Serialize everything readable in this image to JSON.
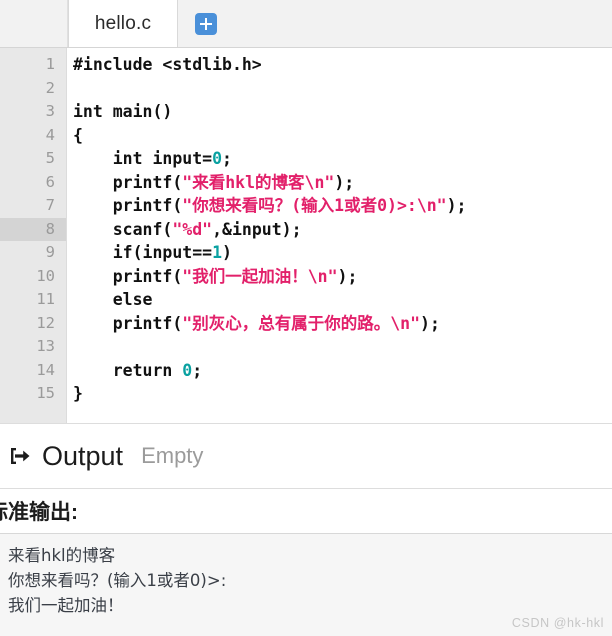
{
  "tabbar": {
    "tab_label": "hello.c",
    "add_tab_title": "+"
  },
  "editor": {
    "active_line": 8,
    "line_numbers": [
      "1",
      "2",
      "3",
      "4",
      "5",
      "6",
      "7",
      "8",
      "9",
      "10",
      "11",
      "12",
      "13",
      "14",
      "15"
    ],
    "lines": [
      {
        "n": 1,
        "parts": [
          {
            "t": "plain",
            "v": "#include <stdlib.h>"
          }
        ]
      },
      {
        "n": 2,
        "parts": [
          {
            "t": "plain",
            "v": ""
          }
        ]
      },
      {
        "n": 3,
        "parts": [
          {
            "t": "plain",
            "v": "int main()"
          }
        ]
      },
      {
        "n": 4,
        "parts": [
          {
            "t": "plain",
            "v": "{"
          }
        ]
      },
      {
        "n": 5,
        "parts": [
          {
            "t": "plain",
            "v": "    int input="
          },
          {
            "t": "num",
            "v": "0"
          },
          {
            "t": "plain",
            "v": ";"
          }
        ]
      },
      {
        "n": 6,
        "parts": [
          {
            "t": "plain",
            "v": "    printf("
          },
          {
            "t": "str",
            "v": "\"来看hkl的博客\\n\""
          },
          {
            "t": "plain",
            "v": ");"
          }
        ]
      },
      {
        "n": 7,
        "parts": [
          {
            "t": "plain",
            "v": "    printf("
          },
          {
            "t": "str",
            "v": "\"你想来看吗？(输入1或者0)>:\\n\""
          },
          {
            "t": "plain",
            "v": ");"
          }
        ]
      },
      {
        "n": 8,
        "parts": [
          {
            "t": "plain",
            "v": "    scanf("
          },
          {
            "t": "str",
            "v": "\"%d\""
          },
          {
            "t": "plain",
            "v": ",&input);"
          }
        ]
      },
      {
        "n": 9,
        "parts": [
          {
            "t": "plain",
            "v": "    if(input=="
          },
          {
            "t": "num",
            "v": "1"
          },
          {
            "t": "plain",
            "v": ")"
          }
        ]
      },
      {
        "n": 10,
        "parts": [
          {
            "t": "plain",
            "v": "    printf("
          },
          {
            "t": "str",
            "v": "\"我们一起加油！\\n\""
          },
          {
            "t": "plain",
            "v": ");"
          }
        ]
      },
      {
        "n": 11,
        "parts": [
          {
            "t": "plain",
            "v": "    else"
          }
        ]
      },
      {
        "n": 12,
        "parts": [
          {
            "t": "plain",
            "v": "    printf("
          },
          {
            "t": "str",
            "v": "\"别灰心，总有属于你的路。\\n\""
          },
          {
            "t": "plain",
            "v": ");"
          }
        ]
      },
      {
        "n": 13,
        "parts": [
          {
            "t": "plain",
            "v": ""
          }
        ]
      },
      {
        "n": 14,
        "parts": [
          {
            "t": "plain",
            "v": "    return "
          },
          {
            "t": "num",
            "v": "0"
          },
          {
            "t": "plain",
            "v": ";"
          }
        ]
      },
      {
        "n": 15,
        "parts": [
          {
            "t": "plain",
            "v": "}"
          }
        ]
      }
    ]
  },
  "output_bar": {
    "icon": "sign-out-icon",
    "title": "Output",
    "status": "Empty"
  },
  "stdout_panel": {
    "header": "标准输出:",
    "lines": [
      "来看hkl的博客",
      "你想来看吗？(输入1或者0)>:",
      "我们一起加油！"
    ]
  },
  "watermark": {
    "text": "CSDN @hk-hkl"
  },
  "colors": {
    "string": "#e2206a",
    "number": "#0aa1a1",
    "accent_blue": "#4a90d9",
    "gutter_bg": "#e8e8e8",
    "gutter_active": "#d4d4d4",
    "console_bg": "#f6f6f6"
  }
}
